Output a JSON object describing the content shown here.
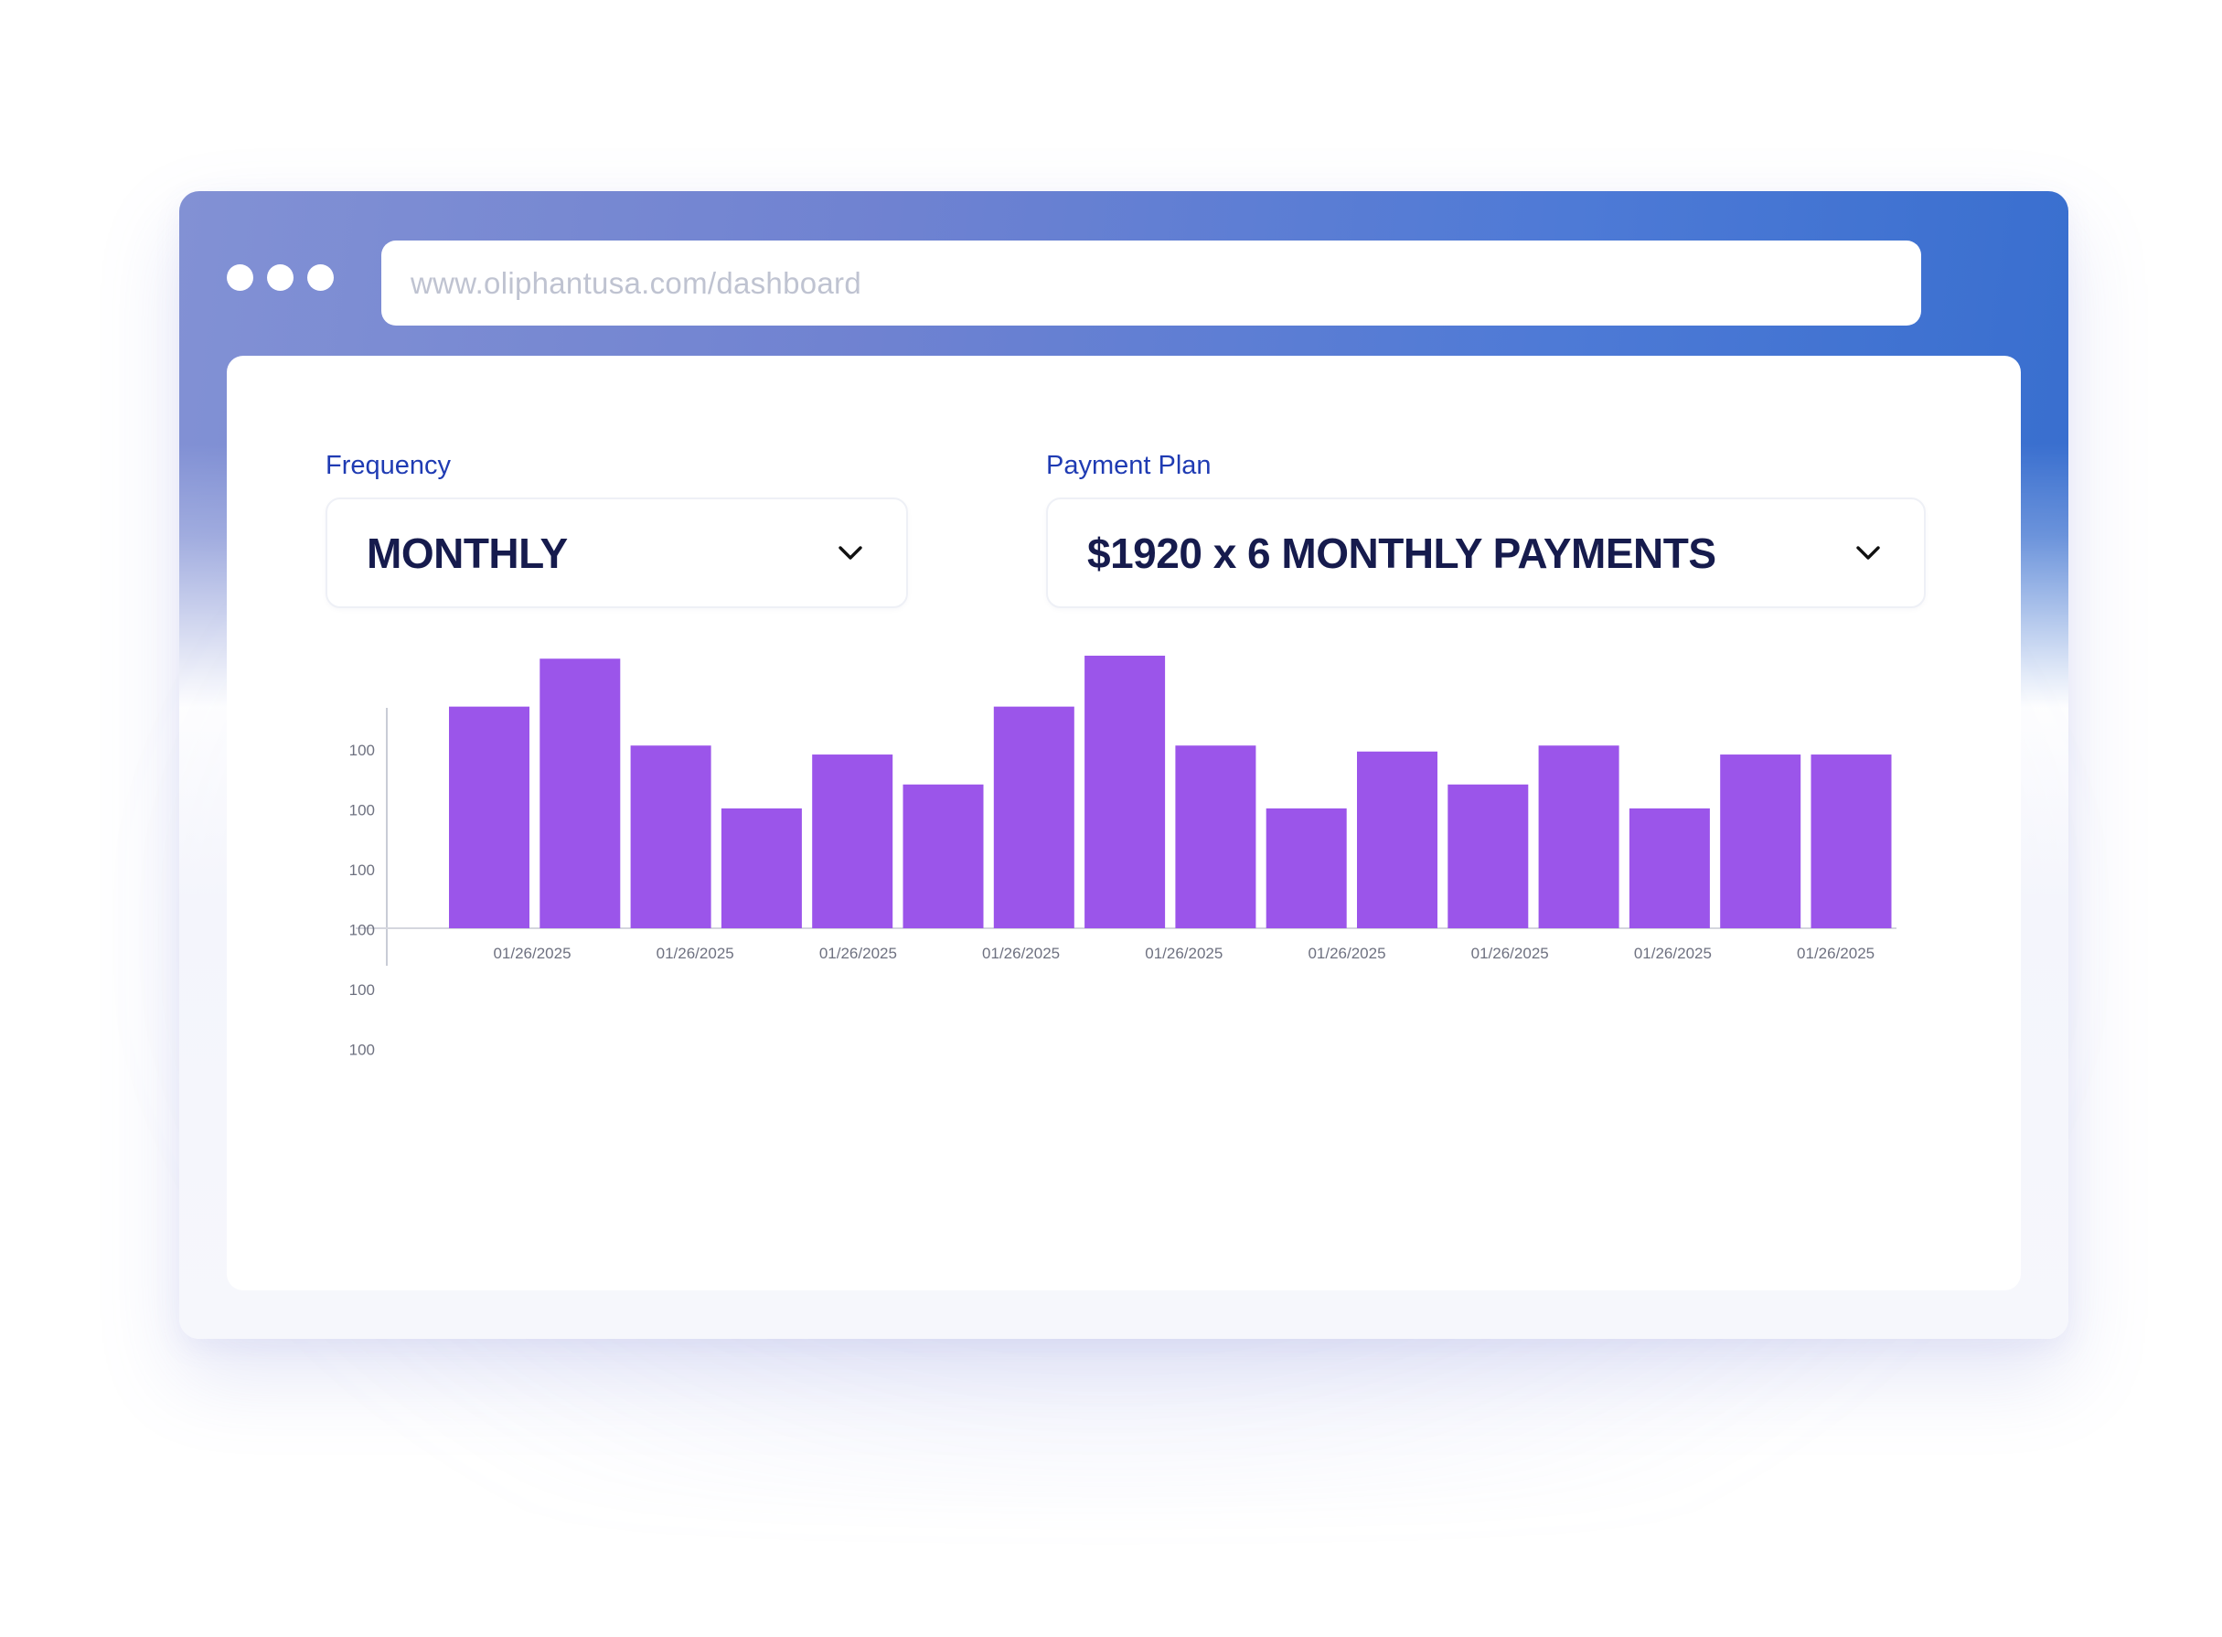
{
  "browser": {
    "url": "www.oliphantusa.com/dashboard"
  },
  "form": {
    "frequency": {
      "label": "Frequency",
      "value": "MONTHLY"
    },
    "payment_plan": {
      "label": "Payment Plan",
      "value": "$1920 x 6 MONTHLY PAYMENTS"
    }
  },
  "icons": {
    "select_chevron": "chevron-down-icon"
  },
  "colors": {
    "bar": "#9b55ea",
    "label": "#1f3bb3",
    "value_text": "#161b4d",
    "chrome_start": "#8291d4",
    "chrome_end": "#346ccd"
  },
  "chart_data": {
    "type": "bar",
    "y_tick_labels": [
      "100",
      "100",
      "100",
      "100",
      "100",
      "100"
    ],
    "x_tick_labels": [
      "01/26/2025",
      "01/26/2025",
      "01/26/2025",
      "01/26/2025",
      "01/26/2025",
      "01/26/2025",
      "01/26/2025",
      "01/26/2025",
      "01/26/2025"
    ],
    "values": [
      3.7,
      4.5,
      3.05,
      2.0,
      2.9,
      2.4,
      3.7,
      4.55,
      3.05,
      2.0,
      2.95,
      2.4,
      3.05,
      2.0,
      2.9,
      2.9
    ],
    "ylim": [
      0,
      6
    ],
    "grid": false,
    "legend": "none"
  }
}
